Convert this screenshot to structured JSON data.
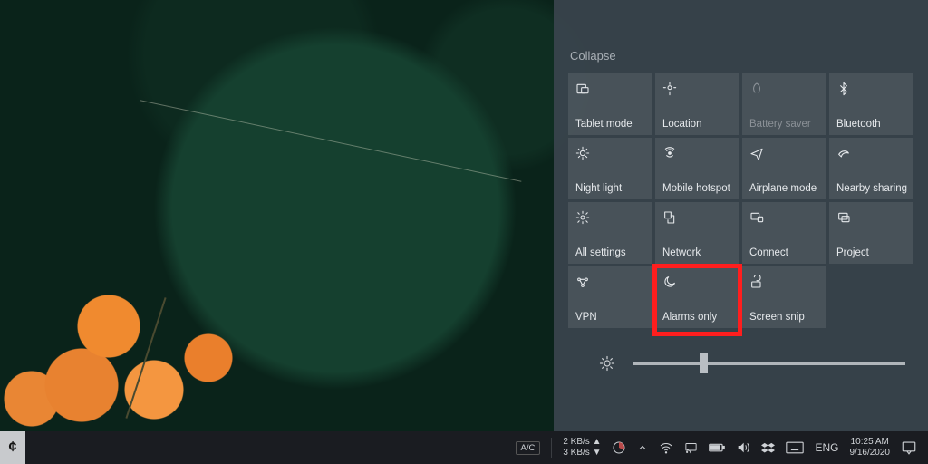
{
  "action_center": {
    "collapse_label": "Collapse",
    "brightness_value": 25,
    "tiles": [
      {
        "id": "tablet-mode",
        "label": "Tablet mode",
        "icon": "tablet-icon",
        "dim": false
      },
      {
        "id": "location",
        "label": "Location",
        "icon": "location-icon",
        "dim": false
      },
      {
        "id": "battery-saver",
        "label": "Battery saver",
        "icon": "leaf-icon",
        "dim": true
      },
      {
        "id": "bluetooth",
        "label": "Bluetooth",
        "icon": "bluetooth-icon",
        "dim": false
      },
      {
        "id": "night-light",
        "label": "Night light",
        "icon": "sun-icon",
        "dim": false
      },
      {
        "id": "mobile-hotspot",
        "label": "Mobile hotspot",
        "icon": "hotspot-icon",
        "dim": false
      },
      {
        "id": "airplane-mode",
        "label": "Airplane mode",
        "icon": "airplane-icon",
        "dim": false
      },
      {
        "id": "nearby-sharing",
        "label": "Nearby sharing",
        "icon": "share-icon",
        "dim": false
      },
      {
        "id": "all-settings",
        "label": "All settings",
        "icon": "gear-icon",
        "dim": false
      },
      {
        "id": "network",
        "label": "Network",
        "icon": "network-icon",
        "dim": false
      },
      {
        "id": "connect",
        "label": "Connect",
        "icon": "connect-icon",
        "dim": false
      },
      {
        "id": "project",
        "label": "Project",
        "icon": "project-icon",
        "dim": false
      },
      {
        "id": "vpn",
        "label": "VPN",
        "icon": "vpn-icon",
        "dim": false
      },
      {
        "id": "alarms-only",
        "label": "Alarms only",
        "icon": "moon-icon",
        "dim": false,
        "highlighted": true
      },
      {
        "id": "screen-snip",
        "label": "Screen snip",
        "icon": "snip-icon",
        "dim": false
      }
    ]
  },
  "taskbar": {
    "power_mode": "A/C",
    "net_up": "2 KB/s ▲",
    "net_down": "3 KB/s ▼",
    "lang": "ENG",
    "time": "10:25 AM",
    "date": "9/16/2020",
    "tray_icons": [
      "caret-up",
      "wifi",
      "cast",
      "battery",
      "volume",
      "dropbox",
      "keyboard"
    ]
  },
  "highlight_color": "#ff1e1e"
}
